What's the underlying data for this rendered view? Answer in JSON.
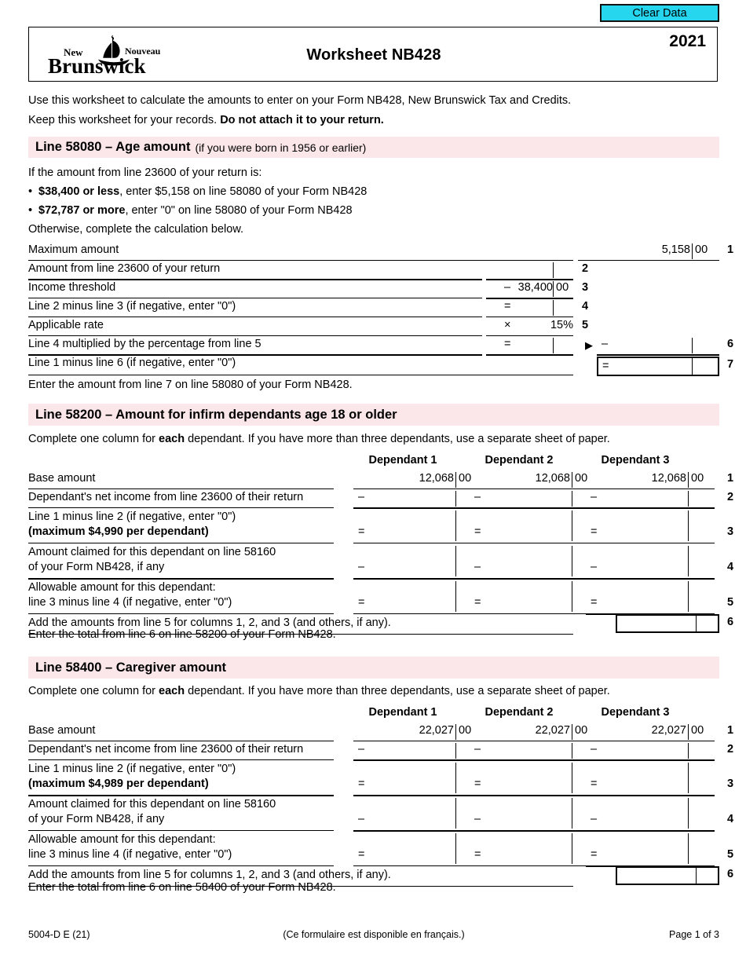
{
  "toolbar": {
    "clear_data_label": "Clear Data"
  },
  "header": {
    "title": "Worksheet NB428",
    "year": "2021",
    "logo_new": "New",
    "logo_nouveau": "Nouveau",
    "logo_brunswick": "Brunswick"
  },
  "intro": {
    "line1": "Use this worksheet to calculate the amounts to enter on your Form NB428, New Brunswick Tax and Credits.",
    "line2_a": "Keep this worksheet for your records. ",
    "line2_b": "Do not attach it to your return."
  },
  "section_age": {
    "band_title": "Line 58080 – Age amount",
    "band_sub": "(if you were born in 1956 or earlier)",
    "intro": "If the amount from line 23600 of your return is:",
    "bullet1_bold": "$38,400 or less",
    "bullet1_rest": ", enter $5,158 on line 58080 of your Form NB428",
    "bullet2_bold": "$72,787 or more",
    "bullet2_rest": ", enter \"0\" on line 58080 of your Form NB428",
    "otherwise": "Otherwise, complete the calculation below.",
    "rows": [
      {
        "no": "1",
        "label": "Maximum amount",
        "op": "",
        "dollars": "5,158",
        "cents": "00"
      },
      {
        "no": "2",
        "label": "Amount from line 23600 of your return",
        "op": "",
        "dollars": "",
        "cents": ""
      },
      {
        "no": "3",
        "label": "Income threshold",
        "op": "–",
        "dollars": "38,400",
        "cents": "00"
      },
      {
        "no": "4",
        "label": "Line 2 minus line 3 (if negative, enter \"0\")",
        "op": "=",
        "dollars": "",
        "cents": ""
      },
      {
        "no": "5",
        "label": "Applicable rate",
        "op": "×",
        "dollars": "15%",
        "cents": ""
      },
      {
        "no": "6",
        "label": "Line 4 multiplied by the percentage from line 5",
        "op": "=",
        "dollars": "",
        "cents": ""
      },
      {
        "no": "7",
        "label": "Line 1 minus line 6 (if negative, enter \"0\")",
        "op": "",
        "dollars": "",
        "cents": ""
      }
    ],
    "right_op_6": "–",
    "right_op_7": "=",
    "closing": "Enter the amount from line 7 on line 58080 of your Form NB428."
  },
  "section_infirm": {
    "band_title": "Line 58200 – Amount for infirm dependants age 18 or older",
    "instr_a": "Complete one column for ",
    "instr_b": "each",
    "instr_c": " dependant. If you have more than three dependants, use a separate sheet of paper.",
    "col_headers": [
      "Dependant 1",
      "Dependant 2",
      "Dependant 3"
    ],
    "rows": [
      {
        "no": "1",
        "label1": "Base amount",
        "label2": "",
        "op": "",
        "dollars": "12,068",
        "cents": "00"
      },
      {
        "no": "2",
        "label1": "Dependant's net income from line 23600 of their return",
        "label2": "",
        "op": "–",
        "dollars": "",
        "cents": ""
      },
      {
        "no": "3",
        "label1": "Line 1 minus line 2 (if negative, enter \"0\")",
        "label2": "(maximum $4,990 per dependant)",
        "label2_bold": true,
        "op": "=",
        "dollars": "",
        "cents": ""
      },
      {
        "no": "4",
        "label1": "Amount claimed for this dependant on line 58160",
        "label2": "of your Form NB428, if any",
        "op": "–",
        "dollars": "",
        "cents": ""
      },
      {
        "no": "5",
        "label1": "Allowable amount for this dependant:",
        "label2": "line 3 minus line 4 (if negative, enter \"0\")",
        "op": "=",
        "dollars": "",
        "cents": ""
      }
    ],
    "total_label": "Add the amounts from line 5 for columns 1, 2, and 3 (and others, if any).",
    "total_no": "6",
    "closing": "Enter the total from line 6 on line 58200 of your Form NB428."
  },
  "section_caregiver": {
    "band_title": "Line 58400 – Caregiver amount",
    "instr_a": "Complete one column for ",
    "instr_b": "each",
    "instr_c": " dependant. If you have more than three dependants, use a separate sheet of paper.",
    "col_headers": [
      "Dependant 1",
      "Dependant 2",
      "Dependant 3"
    ],
    "rows": [
      {
        "no": "1",
        "label1": "Base amount",
        "label2": "",
        "op": "",
        "dollars": "22,027",
        "cents": "00"
      },
      {
        "no": "2",
        "label1": "Dependant's net income from line 23600 of their return",
        "label2": "",
        "op": "–",
        "dollars": "",
        "cents": ""
      },
      {
        "no": "3",
        "label1": "Line 1 minus line 2 (if negative, enter \"0\")",
        "label2": "(maximum $4,989 per dependant)",
        "label2_bold": true,
        "op": "=",
        "dollars": "",
        "cents": ""
      },
      {
        "no": "4",
        "label1": "Amount claimed for this dependant on line 58160",
        "label2": "of your Form NB428, if any",
        "op": "–",
        "dollars": "",
        "cents": ""
      },
      {
        "no": "5",
        "label1": "Allowable amount for this dependant:",
        "label2": "line 3 minus line 4 (if negative, enter \"0\")",
        "op": "=",
        "dollars": "",
        "cents": ""
      }
    ],
    "total_label": "Add the amounts from line 5 for columns 1, 2, and 3 (and others, if any).",
    "total_no": "6",
    "closing": "Enter the total from line 6 on line 58400 of your Form NB428."
  },
  "footer": {
    "left": "5004-D E (21)",
    "center": "(Ce formulaire est disponible en français.)",
    "right": "Page 1 of 3"
  },
  "colors": {
    "band_background": "#fbe7e9",
    "clear_button": "#26d6ee"
  }
}
